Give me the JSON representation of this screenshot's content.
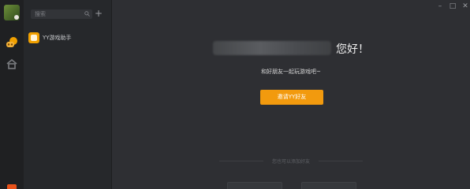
{
  "sidebar": {
    "search_placeholder": "搜索",
    "add_label": "+",
    "friends": [
      {
        "name": "YY游戏助手"
      }
    ]
  },
  "main": {
    "greeting": "您好！",
    "subtitle": "和好朋友一起玩游戏吧~",
    "invite_label": "邀请YY好友",
    "divider_text": "您也可以添加好友"
  },
  "window_controls": {
    "minimize": "–",
    "maximize": "□",
    "close": "✕"
  },
  "colors": {
    "accent": "#f29a0e",
    "background": "#2e2f33",
    "sidebar": "#26282b",
    "rail": "#1f2022"
  },
  "icons": [
    "game-controller-icon",
    "home-icon",
    "search-icon",
    "friend-assistant-icon"
  ]
}
